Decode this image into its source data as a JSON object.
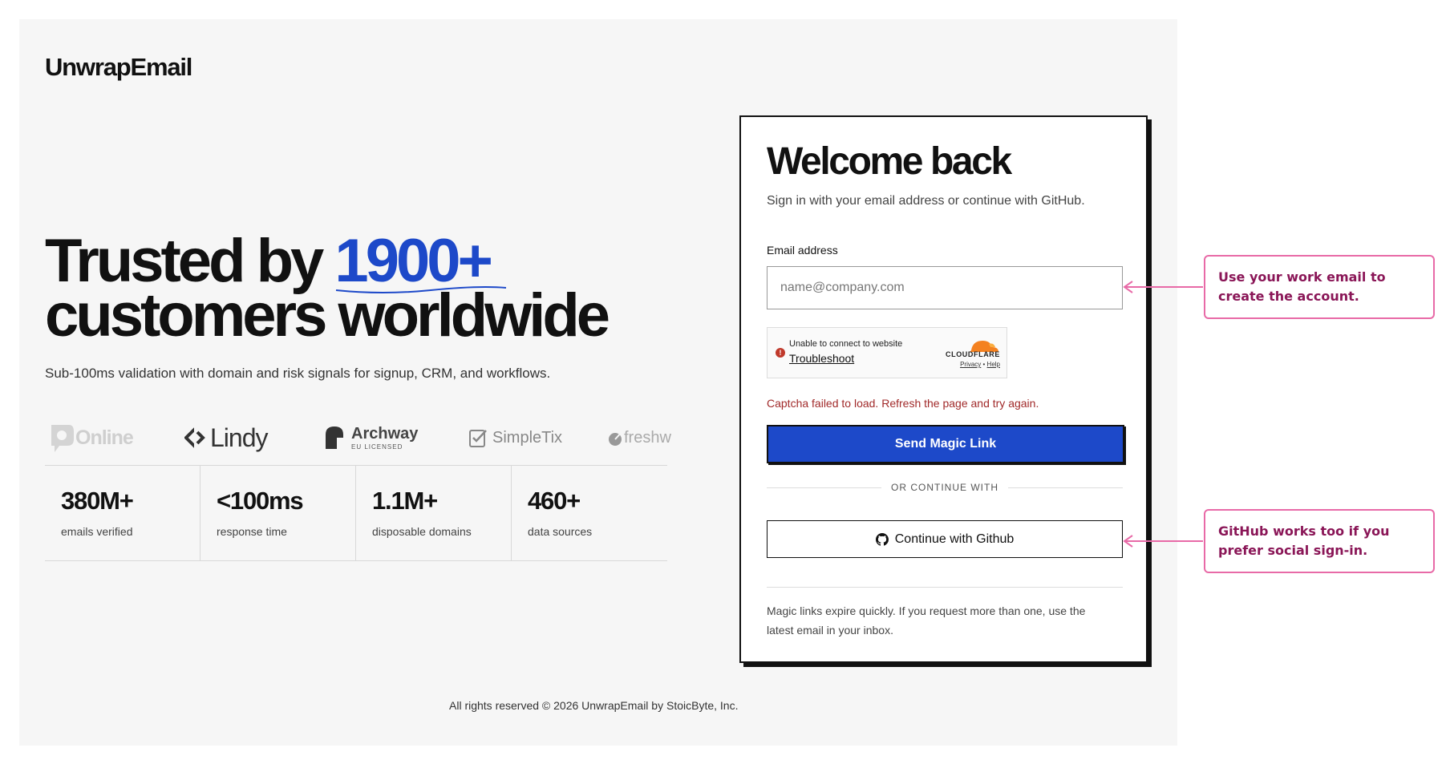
{
  "brand": {
    "name": "UnwrapEmail"
  },
  "hero": {
    "line1_prefix": "Trusted by ",
    "line1_accent": "1900+",
    "line2": "customers worldwide",
    "subtitle": "Sub-100ms validation with domain and risk signals for signup, CRM, and workflows."
  },
  "logos": [
    {
      "name": "Online",
      "icon": "online-logo"
    },
    {
      "name": "Lindy",
      "icon": "lindy-logo"
    },
    {
      "name": "Archway",
      "tag": "EU LICENSED",
      "icon": "archway-logo"
    },
    {
      "name": "SimpleTix",
      "icon": "simpletix-logo"
    },
    {
      "name": "freshw",
      "icon": "freshworks-logo"
    }
  ],
  "stats": [
    {
      "value": "380M+",
      "label": "emails verified"
    },
    {
      "value": "<100ms",
      "label": "response time"
    },
    {
      "value": "1.1M+",
      "label": "disposable domains"
    },
    {
      "value": "460+",
      "label": "data sources"
    }
  ],
  "footer": "All rights reserved © 2026 UnwrapEmail by StoicByte, Inc.",
  "card": {
    "title": "Welcome back",
    "subtitle": "Sign in with your email address or continue with GitHub.",
    "email_label": "Email address",
    "email_placeholder": "name@company.com",
    "email_value": "",
    "captcha": {
      "message": "Unable to connect to website",
      "troubleshoot": "Troubleshoot",
      "provider": "CLOUDFLARE",
      "privacy": "Privacy",
      "dot": " • ",
      "help": "Help"
    },
    "error": "Captcha failed to load. Refresh the page and try again.",
    "send_label": "Send Magic Link",
    "divider": "OR CONTINUE WITH",
    "github_label": "Continue with Github",
    "note": "Magic links expire quickly. If you request more than one, use the latest email in your inbox."
  },
  "callouts": [
    {
      "text": "Use your work email to create the account."
    },
    {
      "text": "GitHub works too if you prefer social sign-in."
    }
  ],
  "colors": {
    "accent": "#1d49c9",
    "error": "#a12a2a",
    "callout_border": "#e86aa7",
    "callout_text": "#8a1657"
  }
}
